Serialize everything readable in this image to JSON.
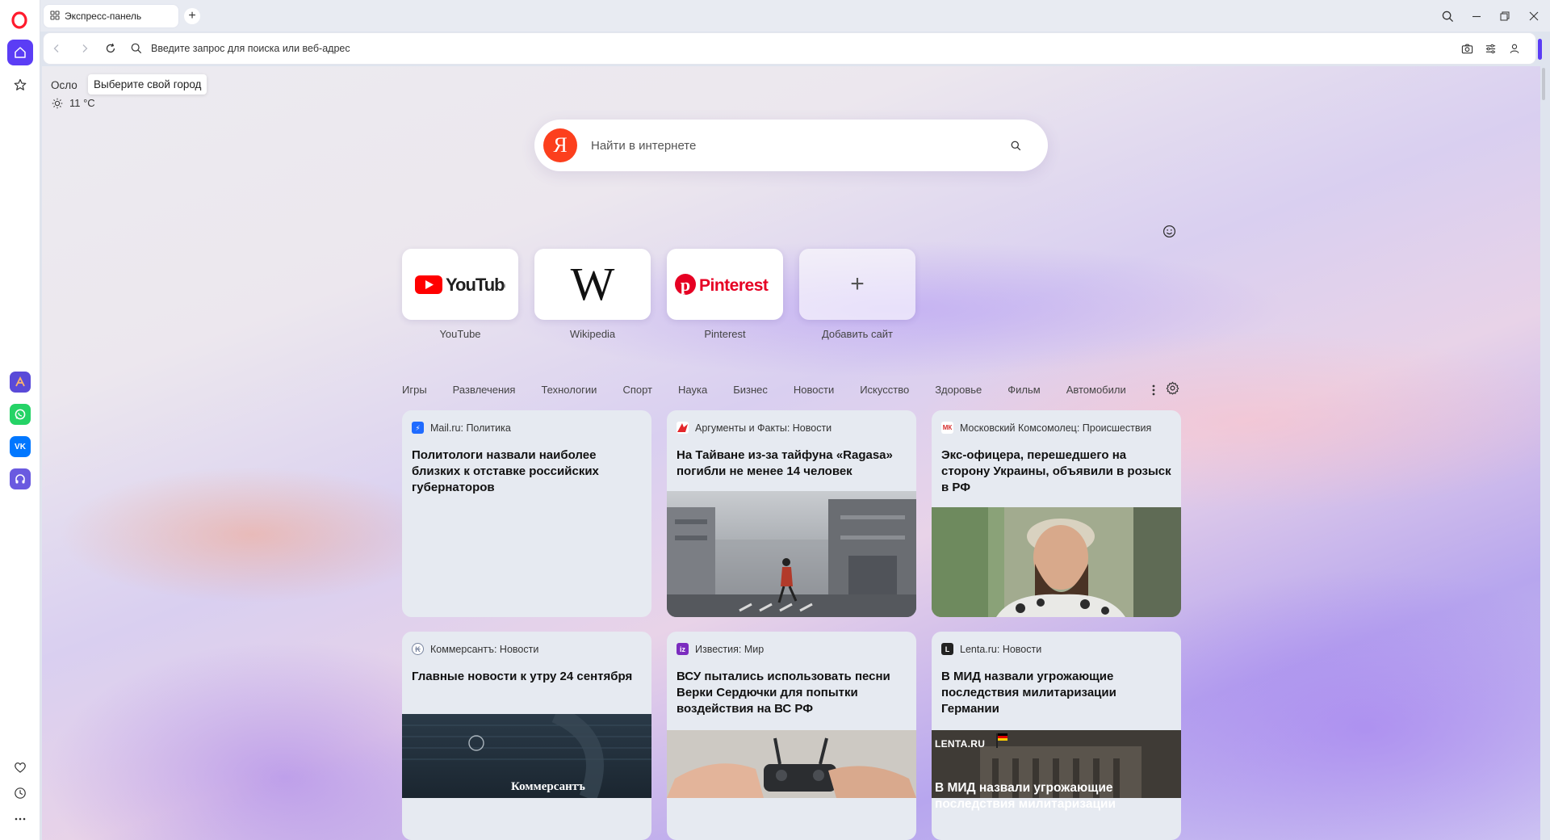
{
  "tab": {
    "title": "Экспресс-панель"
  },
  "address": {
    "placeholder": "Введите запрос для поиска или веб-адрес"
  },
  "weather": {
    "city": "Осло",
    "tooltip": "Выберите свой город",
    "temperature": "11 °C"
  },
  "search": {
    "placeholder": "Найти в интернете",
    "engine_logo": "Я"
  },
  "speed_dials": [
    {
      "label": "YouTube",
      "logo_text": "YouTube"
    },
    {
      "label": "Wikipedia",
      "logo_text": "W"
    },
    {
      "label": "Pinterest",
      "logo_text": "Pinterest"
    },
    {
      "label": "Добавить сайт",
      "logo_text": "+"
    }
  ],
  "categories": [
    "Игры",
    "Развлечения",
    "Технологии",
    "Спорт",
    "Наука",
    "Бизнес",
    "Новости",
    "Искусство",
    "Здоровье",
    "Фильм",
    "Автомобили"
  ],
  "news": [
    {
      "source": "Mail.ru: Политика",
      "title": "Политологи назвали наиболее близких к отставке российских губернаторов",
      "icon_color": "#1f6bff"
    },
    {
      "source": "Аргументы и Факты: Новости",
      "title": "На Тайване из-за тайфуна «Ragasa» погибли не менее 14 человек",
      "icon_color": "#e3262b"
    },
    {
      "source": "Московский Комсомолец: Происшествия",
      "title": "Экс-офицера, перешедшего на сторону Украины, объявили в розыск в РФ",
      "icon_color": "#d62d2d",
      "icon_text": "МК"
    },
    {
      "source": "Коммерсантъ: Новости",
      "title": "Главные новости к утру 24 сентября",
      "icon_color": "#7a86a0",
      "image_text": "Коммерсантъ"
    },
    {
      "source": "Известия: Мир",
      "title": "ВСУ пытались использовать песни Верки Сердючки для попытки воздействия на ВС РФ",
      "icon_color": "#7b2cbf",
      "icon_text": "iz"
    },
    {
      "source": "Lenta.ru: Новости",
      "title": "В МИД назвали угрожающие последствия милитаризации Германии",
      "icon_color": "#222222",
      "icon_text": "L",
      "image_brand": "LENTA.RU",
      "image_caption": "В МИД назвали угрожающие последствия милитаризации"
    }
  ],
  "colors": {
    "accent": "#5b3df5",
    "opera_red": "#ff1b2d",
    "yandex_red": "#fc3f1d",
    "youtube_red": "#ff0000",
    "pinterest_red": "#e60023"
  }
}
